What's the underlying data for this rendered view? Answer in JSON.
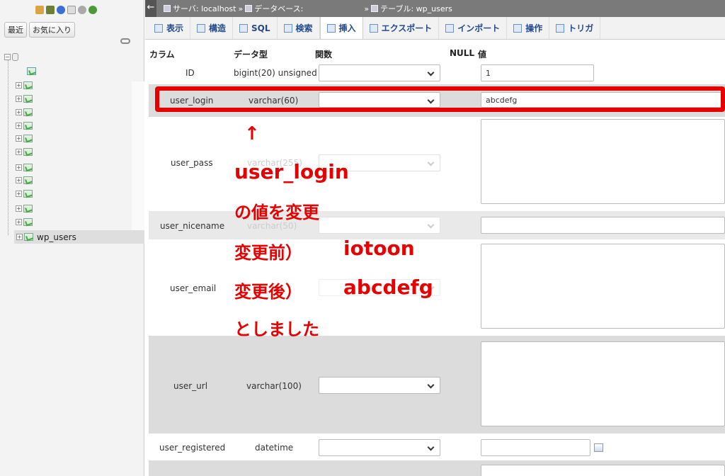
{
  "sidebar": {
    "tab_recent": "最近",
    "tab_favorites": "お気に入り",
    "selected_table": "wp_users"
  },
  "breadcrumb": {
    "server": "サーバ: localhost",
    "sep1": "»",
    "database": "データベース:",
    "sep2": "»",
    "table": "テーブル: wp_users"
  },
  "tabs": [
    {
      "label": "表示",
      "icon": "browse-icon"
    },
    {
      "label": "構造",
      "icon": "structure-icon"
    },
    {
      "label": "SQL",
      "icon": "sql-icon"
    },
    {
      "label": "検索",
      "icon": "search-icon"
    },
    {
      "label": "挿入",
      "icon": "insert-icon",
      "active": true
    },
    {
      "label": "エクスポート",
      "icon": "export-icon"
    },
    {
      "label": "インポート",
      "icon": "import-icon"
    },
    {
      "label": "操作",
      "icon": "operations-icon"
    },
    {
      "label": "トリガ",
      "icon": "triggers-icon"
    }
  ],
  "table_header": {
    "column": "カラム",
    "type": "データ型",
    "function": "関数",
    "null": "NULL",
    "value": "値"
  },
  "rows": [
    {
      "column": "ID",
      "type": "bigint(20) unsigned",
      "value": "1"
    },
    {
      "column": "user_login",
      "type": "varchar(60)",
      "value": "abcdefg"
    },
    {
      "column": "user_pass",
      "type": "varchar(255)",
      "value": ""
    },
    {
      "column": "user_nicename",
      "type": "varchar(50)",
      "value": ""
    },
    {
      "column": "user_email",
      "type": "",
      "value": ""
    },
    {
      "column": "user_url",
      "type": "varchar(100)",
      "value": ""
    },
    {
      "column": "user_registered",
      "type": "datetime",
      "value": ""
    }
  ],
  "annotation": {
    "arrow": "↑",
    "line1": "user_login",
    "line2": "の値を変更",
    "line3_label": "変更前）",
    "line3_value": "iotoon",
    "line4_label": "変更後）",
    "line4_value": "abcdefg",
    "line5": "としました",
    "color": "#e60000"
  }
}
